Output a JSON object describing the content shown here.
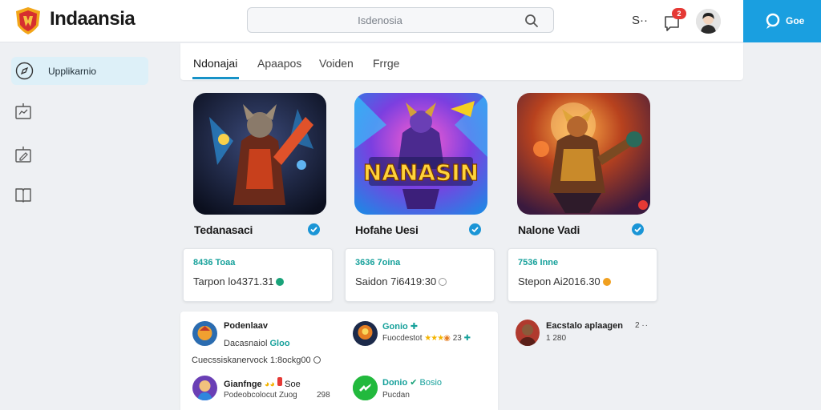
{
  "header": {
    "brand": "Indaansia",
    "search_value": "Isdenosia",
    "right_letter": "S··",
    "notification_count": "2",
    "cta_label": "Goe"
  },
  "sidebar": {
    "items": [
      {
        "label": "Upplikarnio",
        "icon": "compass-icon",
        "active": true
      },
      {
        "label": "",
        "icon": "chart-board-icon"
      },
      {
        "label": "",
        "icon": "edit-board-icon"
      },
      {
        "label": "",
        "icon": "book-icon"
      }
    ]
  },
  "tabs": [
    {
      "label": "Ndonajai",
      "active": true
    },
    {
      "label": "Apaapos"
    },
    {
      "label": "Voiden"
    },
    {
      "label": "Frrge"
    }
  ],
  "games": [
    {
      "title": "Tedanasaci",
      "stat_top": "8436 Toaa",
      "stat_bottom": "Tarpon lo4371.31",
      "dot_color": "#1aa37a",
      "banner": ""
    },
    {
      "title": "Hofahe Uesi",
      "stat_top": "3636 7oina",
      "stat_bottom": "Saidon 7i6419:30",
      "dot_color": "#999999",
      "banner": "NANASIN"
    },
    {
      "title": "Nalone Vadi",
      "stat_top": "7536 Inne",
      "stat_bottom": "Stepon Ai2016.30",
      "dot_color": "#f0a020",
      "banner": ""
    }
  ],
  "feed": [
    {
      "title": "Podenlaav",
      "line1_prefix": "Dacasnaiol",
      "line1_teal": "Gloo",
      "line2": "Cuecssiskanervock 1:8ockg00"
    },
    {
      "title": "Gonio",
      "line1": "Fuocdestot",
      "line1_num": "23"
    },
    {
      "title": "Gianfnge",
      "line1": "Podeobcolocut Zuog",
      "line1_num": "298",
      "badge_text": "Soe"
    },
    {
      "title": "Donio",
      "title_teal": "Bosio",
      "line1": "Pucdan"
    }
  ],
  "right_feed": {
    "title": "Eacstalo aplaagen",
    "time": "2",
    "sub": "1 280"
  },
  "colors": {
    "accent": "#1a9fe0",
    "teal": "#17a19b",
    "tab_underline": "#1792c7"
  }
}
